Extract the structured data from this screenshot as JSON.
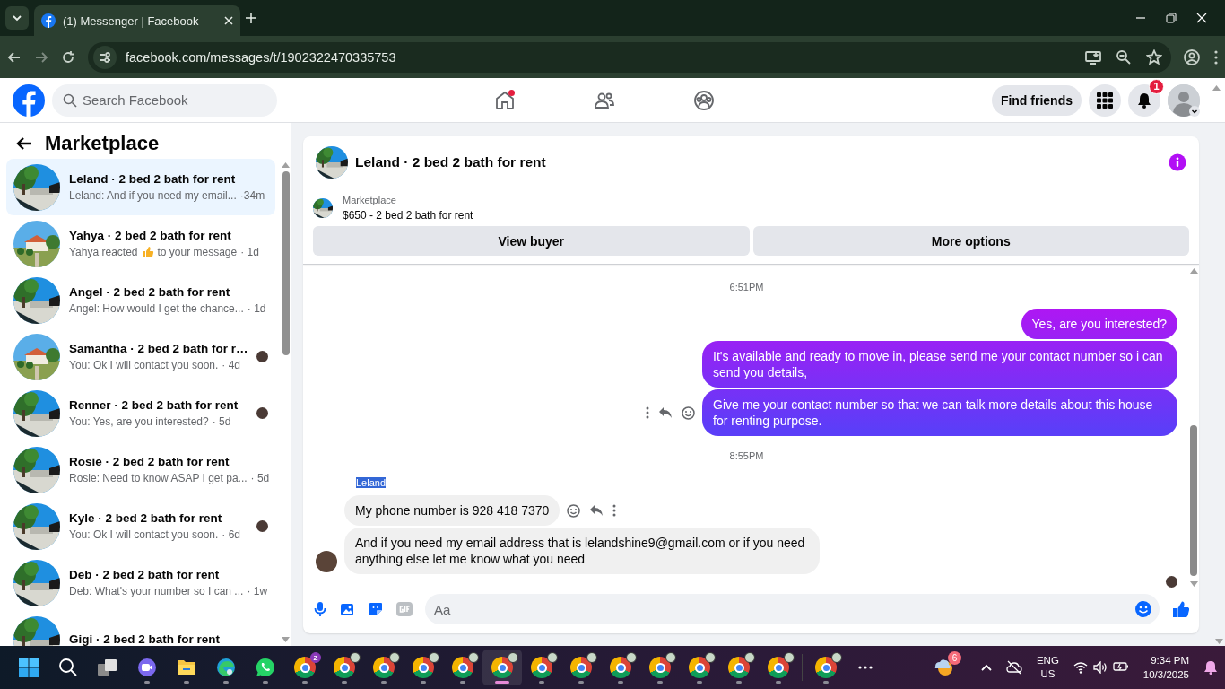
{
  "browser": {
    "tab_title": "(1) Messenger | Facebook",
    "url": "facebook.com/messages/t/1902322470335753"
  },
  "header": {
    "search_placeholder": "Search Facebook",
    "nav": [
      {
        "kind": "home",
        "unread": true
      },
      {
        "kind": "friends",
        "unread": false
      },
      {
        "kind": "groups",
        "unread": false
      }
    ],
    "find_friends": "Find friends",
    "notification_count": "1"
  },
  "sidebar": {
    "title": "Marketplace",
    "threads": [
      {
        "name": "Leland · 2 bed 2 bath for rent",
        "preview": "Leland: And if you need my email...",
        "time": "·34m",
        "selected": true,
        "seen": false
      },
      {
        "name": "Yahya · 2 bed 2 bath for rent",
        "preview": "Yahya reacted",
        "reaction": true,
        "preview_after": "to your message",
        "time": "· 1d",
        "selected": false,
        "seen": false
      },
      {
        "name": "Angel · 2 bed 2 bath for rent",
        "preview": "Angel: How would I get the chance...",
        "time": "· 1d",
        "selected": false,
        "seen": false
      },
      {
        "name": "Samantha · 2 bed 2 bath for r…",
        "preview": "You: Ok I will contact you soon.",
        "time": "· 4d",
        "selected": false,
        "seen": true
      },
      {
        "name": "Renner · 2 bed 2 bath for rent",
        "preview": "You: Yes, are you interested?",
        "time": "· 5d",
        "selected": false,
        "seen": true
      },
      {
        "name": "Rosie · 2 bed 2 bath for rent",
        "preview": "Rosie: Need to know ASAP I get pa...",
        "time": "· 5d",
        "selected": false,
        "seen": false
      },
      {
        "name": "Kyle · 2 bed 2 bath for rent",
        "preview": "You: Ok I will contact you soon.",
        "time": "· 6d",
        "selected": false,
        "seen": true
      },
      {
        "name": "Deb · 2 bed 2 bath for rent",
        "preview": "Deb: What's your number so I can ...",
        "time": "· 1w",
        "selected": false,
        "seen": false
      },
      {
        "name": "Gigi · 2 bed 2 bath for rent",
        "selected": false,
        "seen": false
      }
    ]
  },
  "chat": {
    "title": "Leland · 2 bed 2 bath for rent",
    "listing": {
      "label": "Marketplace",
      "title": "$650 - 2 bed 2 bath for rent"
    },
    "buttons": [
      "View buyer",
      "More options"
    ],
    "messages": [
      {
        "kind": "time",
        "text": "6:51PM"
      },
      {
        "kind": "out",
        "text": "Yes, are you interested?",
        "actions": false
      },
      {
        "kind": "out",
        "text": "It's available and ready to move in, please send me your contact number so i can send you details,",
        "actions": false
      },
      {
        "kind": "out",
        "text": "Give me your contact number so that we can talk more details about this house for renting purpose.",
        "actions": true
      },
      {
        "kind": "time",
        "text": "8:55PM"
      },
      {
        "kind": "sender",
        "text": "Leland",
        "selected": true
      },
      {
        "kind": "in",
        "text": "My phone number is 928 418 7370",
        "actions": true,
        "avatar": false
      },
      {
        "kind": "in",
        "text": "And if you need my email address that is lelandshine9@gmail.com or if you need anything else let me know what you need",
        "actions": false,
        "avatar": true
      }
    ],
    "seen": true,
    "composer": {
      "placeholder": "Aa"
    }
  },
  "taskbar": {
    "apps": [
      {
        "kind": "start",
        "running": false,
        "selected": false
      },
      {
        "kind": "search",
        "running": false,
        "selected": false
      },
      {
        "kind": "task-view",
        "running": false,
        "selected": false
      },
      {
        "kind": "meet",
        "running": true,
        "selected": false
      },
      {
        "kind": "explorer",
        "running": true,
        "selected": false
      },
      {
        "kind": "edge",
        "running": true,
        "selected": false
      },
      {
        "kind": "whatsapp",
        "running": true,
        "selected": false
      },
      {
        "kind": "chrome",
        "badge": "Z",
        "running": true,
        "selected": false
      },
      {
        "kind": "chrome",
        "running": true,
        "selected": false
      },
      {
        "kind": "chrome",
        "running": true,
        "selected": false
      },
      {
        "kind": "chrome",
        "running": true,
        "selected": false
      },
      {
        "kind": "chrome",
        "running": true,
        "selected": false
      },
      {
        "kind": "chrome",
        "running": true,
        "selected": true
      },
      {
        "kind": "chrome",
        "running": true,
        "selected": false
      },
      {
        "kind": "chrome",
        "running": true,
        "selected": false
      },
      {
        "kind": "chrome",
        "running": true,
        "selected": false
      },
      {
        "kind": "chrome",
        "running": true,
        "selected": false
      },
      {
        "kind": "chrome",
        "running": true,
        "selected": false
      },
      {
        "kind": "chrome",
        "running": true,
        "selected": false
      },
      {
        "kind": "chrome",
        "running": true,
        "selected": false
      }
    ],
    "extra_apps": [
      {
        "kind": "chrome",
        "running": true,
        "selected": false
      },
      {
        "kind": "more",
        "running": false,
        "selected": false
      }
    ],
    "weather_badge": "6",
    "language": "ENG",
    "region": "US",
    "time": "9:34 PM",
    "date": "10/3/2025"
  }
}
